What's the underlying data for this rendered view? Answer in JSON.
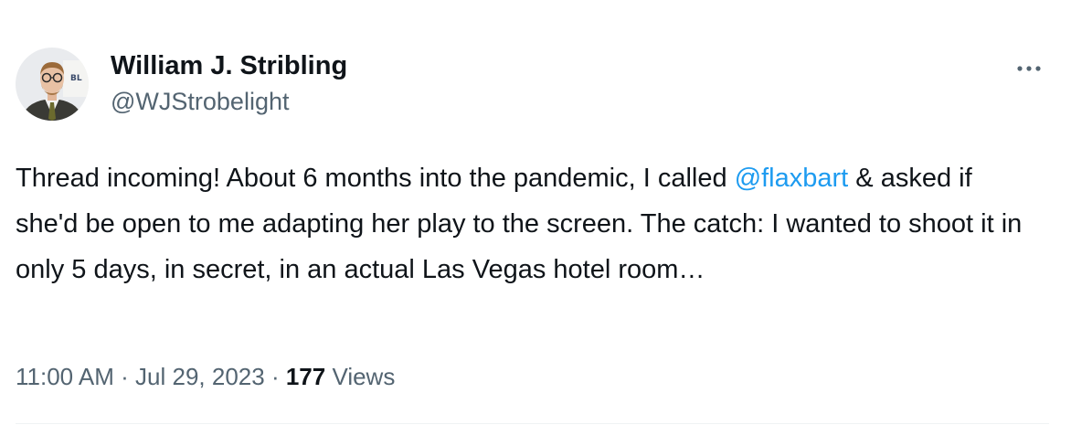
{
  "author": {
    "display_name": "William J. Stribling",
    "handle": "@WJStrobelight"
  },
  "tweet": {
    "text_before_mention": "Thread incoming! About 6 months into the pandemic, I called ",
    "mention": "@flaxbart",
    "text_after_mention": " & asked if she'd be open to me adapting her play to the screen. The catch: I wanted to shoot it in only 5 days, in secret, in an actual Las Vegas hotel room…"
  },
  "meta": {
    "time": "11:00 AM",
    "separator": " · ",
    "date": "Jul 29, 2023",
    "views_count": "177",
    "views_label": " Views"
  },
  "icons": {
    "more": "more-horizontal-icon",
    "avatar": "profile-photo"
  },
  "colors": {
    "text_primary": "#0f1419",
    "text_secondary": "#536471",
    "link": "#1d9bf0",
    "divider": "#eff3f4"
  }
}
